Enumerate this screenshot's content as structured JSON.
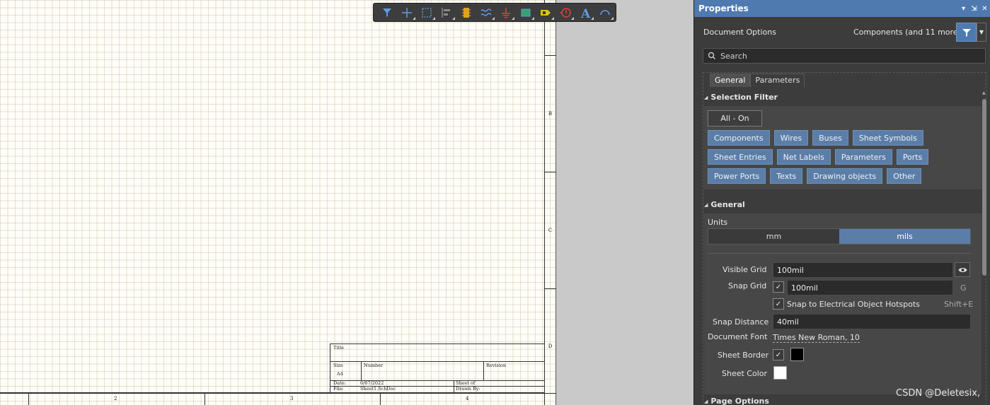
{
  "sheet": {
    "zone_letters": [
      "B",
      "C",
      "D"
    ],
    "zone_numbers": [
      "2",
      "3",
      "4"
    ],
    "title_block": {
      "title_label": "Title",
      "size_label": "Size",
      "size_value": "A4",
      "number_label": "Number",
      "revision_label": "Revision",
      "date_label": "Date:",
      "date_value": "6/07/2022",
      "sheet_label": "Sheet   of",
      "file_label": "File:",
      "file_value": "Sheet1.SchDoc",
      "drawn_by_label": "Drawn By:"
    }
  },
  "toolbar": {
    "icons": [
      "filter-icon",
      "cross-icon",
      "select-rect-icon",
      "align-icon",
      "component-icon",
      "bus-icon",
      "ground-icon",
      "harness-icon",
      "port-icon",
      "directive-icon",
      "text-icon",
      "arc-icon"
    ],
    "colors": {
      "background": "#3d3d3d",
      "accent": "#5b8ed6"
    }
  },
  "panel": {
    "title": "Properties",
    "header_controls": [
      "▾",
      "⇲",
      "✕"
    ],
    "document_options": "Document Options",
    "components_more": "Components (and 11 more)",
    "search_placeholder": "Search",
    "tabs": [
      "General",
      "Parameters"
    ],
    "selection_filter": {
      "heading": "Selection Filter",
      "all_on": "All - On",
      "rows": [
        [
          "Components",
          "Wires",
          "Buses",
          "Sheet Symbols"
        ],
        [
          "Sheet Entries",
          "Net Labels",
          "Parameters",
          "Ports"
        ],
        [
          "Power Ports",
          "Texts",
          "Drawing objects",
          "Other"
        ]
      ]
    },
    "general": {
      "heading": "General",
      "units_label": "Units",
      "units": [
        "mm",
        "mils"
      ],
      "units_selected": "mils",
      "visible_grid_label": "Visible Grid",
      "visible_grid_value": "100mil",
      "snap_grid_label": "Snap Grid",
      "snap_grid_value": "100mil",
      "snap_grid_hint": "G",
      "snap_hotspots_label": "Snap to Electrical Object Hotspots",
      "snap_hotspots_hint": "Shift+E",
      "snap_distance_label": "Snap Distance",
      "snap_distance_value": "40mil",
      "document_font_label": "Document Font",
      "document_font_value": "Times New Roman, 10",
      "sheet_border_label": "Sheet Border",
      "sheet_border_color": "#000000",
      "sheet_color_label": "Sheet Color",
      "sheet_color": "#ffffff"
    },
    "page_options_heading": "Page Options",
    "colors": {
      "header": "#4e7ab0",
      "chip": "#5b7ea8",
      "panel_bg": "#3c3c3c"
    }
  },
  "watermark": "CSDN @Deletesix,"
}
